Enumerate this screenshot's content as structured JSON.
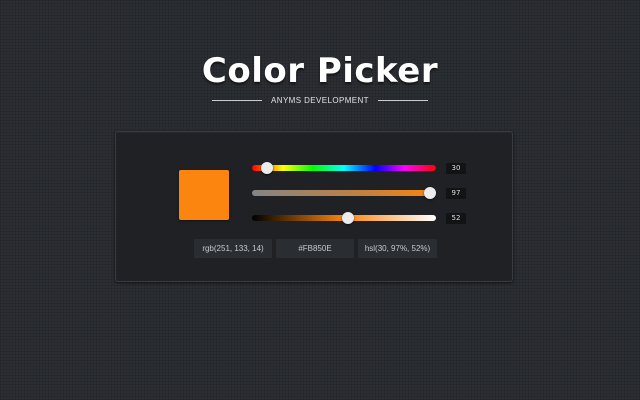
{
  "header": {
    "title": "Color Picker",
    "subtitle": "ANYMS DEVELOPMENT"
  },
  "color": {
    "hex": "#FB850E",
    "swatch_color": "#fb850e"
  },
  "sliders": {
    "hue": {
      "value": "30",
      "max": 360
    },
    "saturation": {
      "value": "97",
      "max": 100
    },
    "lightness": {
      "value": "52",
      "max": 100
    }
  },
  "outputs": {
    "rgb": "rgb(251, 133, 14)",
    "hex": "#FB850E",
    "hsl": "hsl(30, 97%, 52%)"
  }
}
